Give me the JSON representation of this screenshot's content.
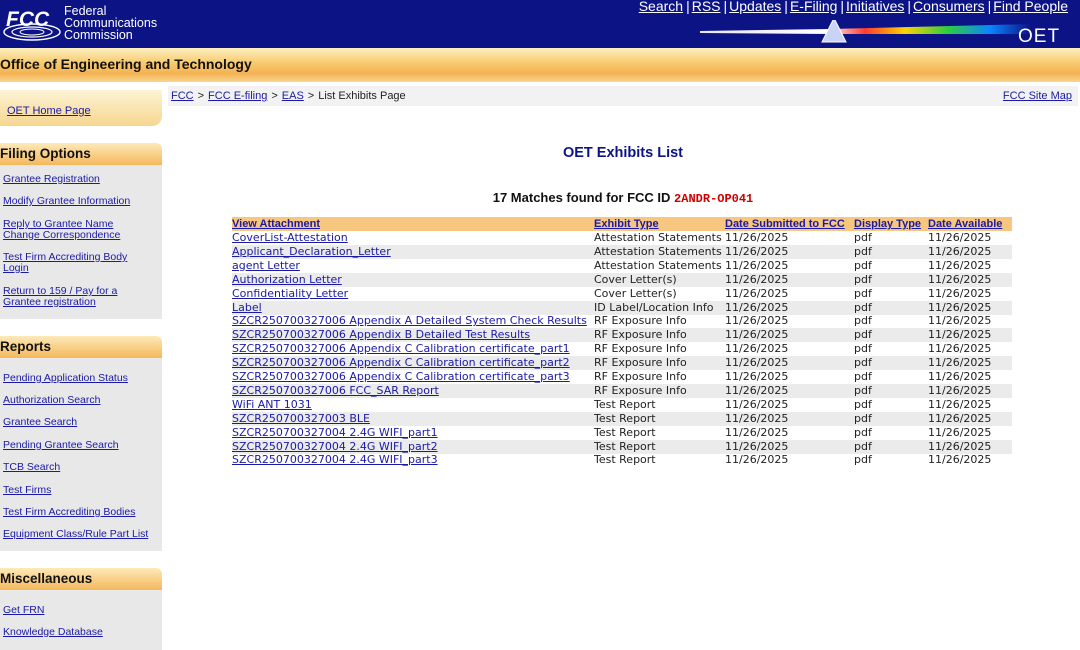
{
  "header": {
    "logo_text": "FCC",
    "agency_lines": [
      "Federal",
      "Communications",
      "Commission"
    ],
    "nav": [
      "Search",
      "RSS",
      "Updates",
      "E-Filing",
      "Initiatives",
      "Consumers",
      "Find People"
    ],
    "oet_mark": "OET",
    "band_title": "Office of Engineering and Technology"
  },
  "sidebar": {
    "home": "OET Home Page",
    "filing_heading": "Filing Options",
    "filing_items": [
      "Grantee Registration",
      "Modify Grantee Information",
      "Reply to Grantee Name Change Correspondence",
      "Test Firm Accrediting Body Login",
      "Return to 159 / Pay for a Grantee registration"
    ],
    "reports_heading": "Reports",
    "reports_items": [
      "Pending Application Status",
      "Authorization Search",
      "Grantee Search",
      "Pending Grantee Search",
      "TCB Search",
      "Test Firms",
      "Test Firm Accrediting Bodies",
      "Equipment Class/Rule Part List"
    ],
    "misc_heading": "Miscellaneous",
    "misc_items": [
      "Get FRN",
      "Knowledge Database"
    ]
  },
  "breadcrumb": {
    "items": [
      "FCC",
      "FCC E-filing",
      "EAS"
    ],
    "current": "List Exhibits Page",
    "site_map": "FCC Site Map"
  },
  "main": {
    "title": "OET Exhibits List",
    "matches_text": "17 Matches found for FCC ID",
    "fcc_id": "2ANDR-OP041",
    "columns": [
      "View Attachment",
      "Exhibit Type",
      "Date Submitted to FCC",
      "Display Type",
      "Date Available"
    ],
    "rows": [
      [
        "CoverList-Attestation",
        "Attestation Statements",
        "11/26/2025",
        "pdf",
        "11/26/2025"
      ],
      [
        "Applicant_Declaration_Letter",
        "Attestation Statements",
        "11/26/2025",
        "pdf",
        "11/26/2025"
      ],
      [
        "agent Letter",
        "Attestation Statements",
        "11/26/2025",
        "pdf",
        "11/26/2025"
      ],
      [
        "Authorization Letter",
        "Cover Letter(s)",
        "11/26/2025",
        "pdf",
        "11/26/2025"
      ],
      [
        "Confidentiality Letter",
        "Cover Letter(s)",
        "11/26/2025",
        "pdf",
        "11/26/2025"
      ],
      [
        "Label",
        "ID Label/Location Info",
        "11/26/2025",
        "pdf",
        "11/26/2025"
      ],
      [
        "SZCR250700327006 Appendix A Detailed System Check Results",
        "RF Exposure Info",
        "11/26/2025",
        "pdf",
        "11/26/2025"
      ],
      [
        "SZCR250700327006 Appendix B Detailed Test Results",
        "RF Exposure Info",
        "11/26/2025",
        "pdf",
        "11/26/2025"
      ],
      [
        "SZCR250700327006 Appendix C Calibration certificate_part1",
        "RF Exposure Info",
        "11/26/2025",
        "pdf",
        "11/26/2025"
      ],
      [
        "SZCR250700327006 Appendix C Calibration certificate_part2",
        "RF Exposure Info",
        "11/26/2025",
        "pdf",
        "11/26/2025"
      ],
      [
        "SZCR250700327006 Appendix C Calibration certificate_part3",
        "RF Exposure Info",
        "11/26/2025",
        "pdf",
        "11/26/2025"
      ],
      [
        "SZCR250700327006 FCC_SAR Report",
        "RF Exposure Info",
        "11/26/2025",
        "pdf",
        "11/26/2025"
      ],
      [
        "WiFi ANT 1031",
        "Test Report",
        "11/26/2025",
        "pdf",
        "11/26/2025"
      ],
      [
        "SZCR250700327003 BLE",
        "Test Report",
        "11/26/2025",
        "pdf",
        "11/26/2025"
      ],
      [
        "SZCR250700327004 2.4G WIFI_part1",
        "Test Report",
        "11/26/2025",
        "pdf",
        "11/26/2025"
      ],
      [
        "SZCR250700327004 2.4G WIFI_part2",
        "Test Report",
        "11/26/2025",
        "pdf",
        "11/26/2025"
      ],
      [
        "SZCR250700327004 2.4G WIFI_part3",
        "Test Report",
        "11/26/2025",
        "pdf",
        "11/26/2025"
      ]
    ]
  },
  "colors": {
    "header_bg": "#0c1385",
    "band_orange": "#f4b85c",
    "link": "#1a1aa6",
    "fcc_id_red": "#cc0000",
    "table_header": "#f8c77f"
  }
}
